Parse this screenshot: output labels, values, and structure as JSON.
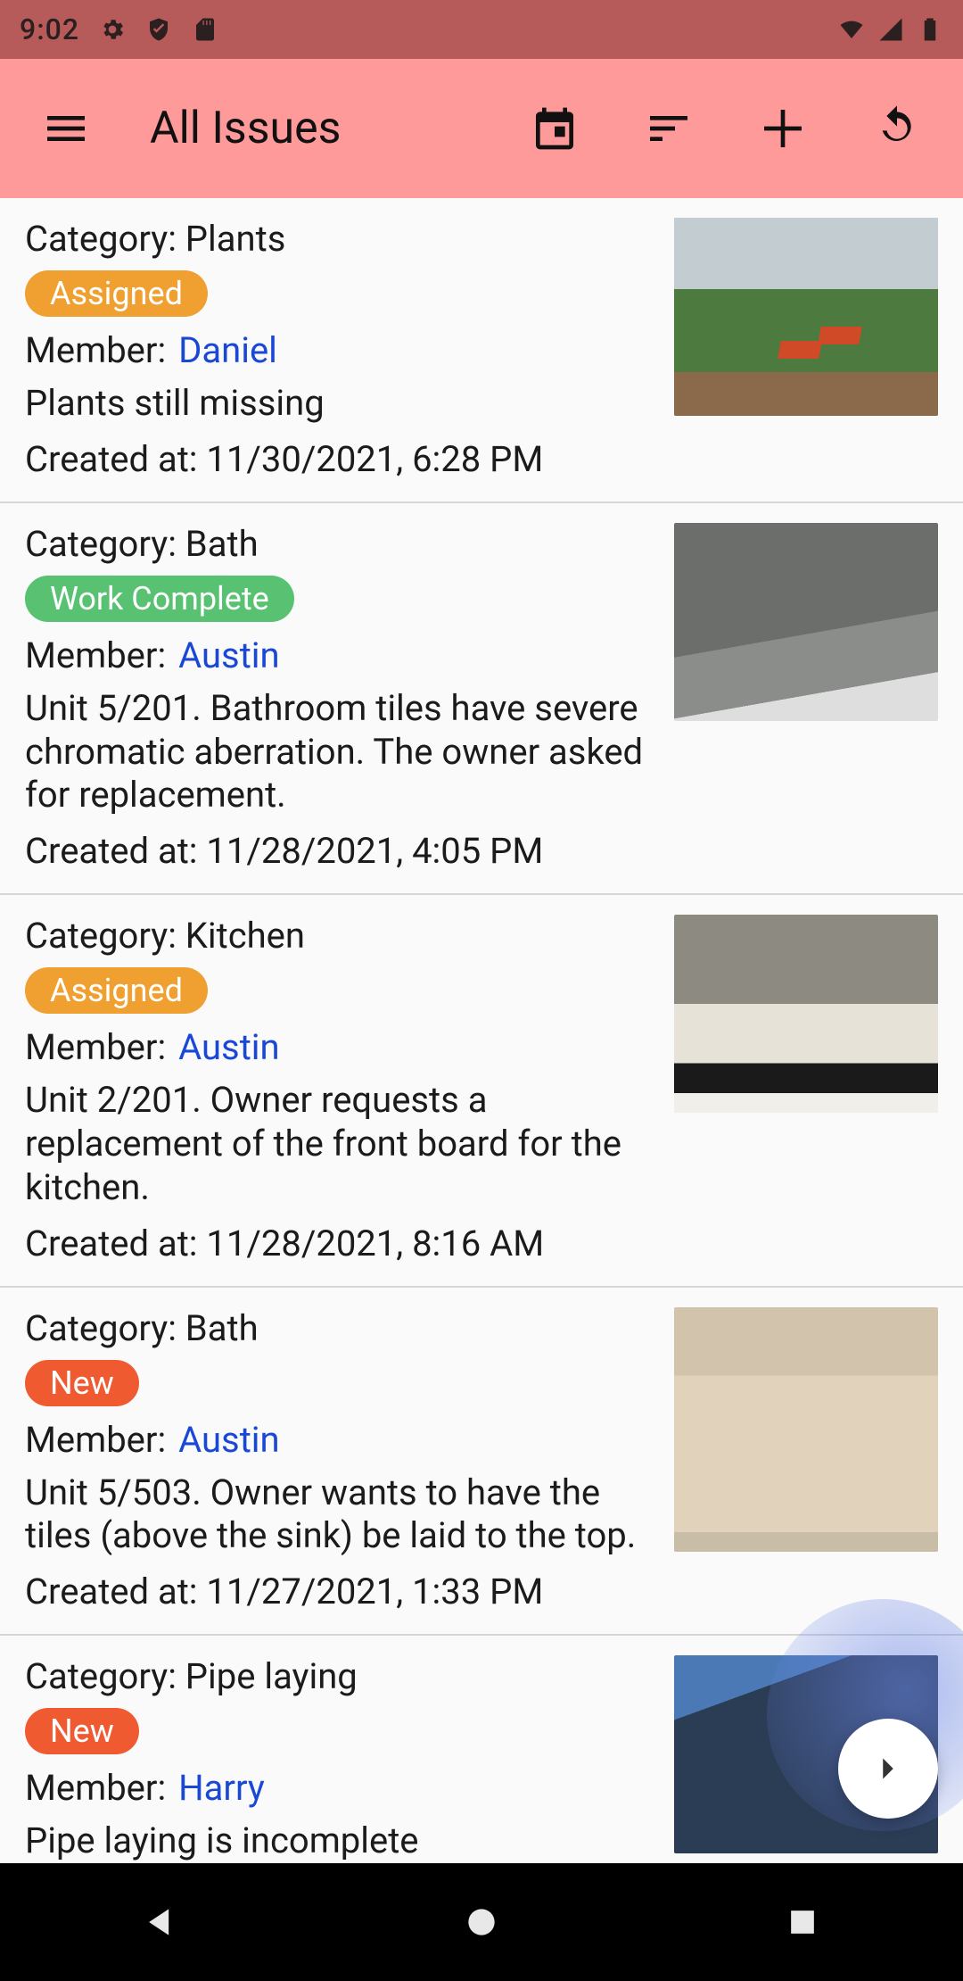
{
  "status": {
    "time": "9:02"
  },
  "appbar": {
    "title": "All Issues"
  },
  "labels": {
    "category_prefix": "Category: ",
    "member_prefix": "Member:",
    "created_prefix": "Created at: "
  },
  "status_kinds": {
    "assigned": "Assigned",
    "complete": "Work Complete",
    "new": "New"
  },
  "status_colors": {
    "assigned": "#f0a030",
    "complete": "#58c172",
    "new": "#f05a30"
  },
  "accent": {
    "link": "#1a48d6"
  },
  "issues": [
    {
      "category": "Plants",
      "status": "assigned",
      "member": "Daniel",
      "description": "Plants still missing",
      "created": "11/30/2021, 6:28 PM",
      "thumb": "plants"
    },
    {
      "category": "Bath",
      "status": "complete",
      "member": "Austin",
      "description": "Unit 5/201. Bathroom tiles have severe chromatic aberration. The owner asked for replacement.",
      "created": "11/28/2021, 4:05 PM",
      "thumb": "bath1"
    },
    {
      "category": "Kitchen",
      "status": "assigned",
      "member": "Austin",
      "description": "Unit 2/201. Owner requests a replacement of the front board for the kitchen.",
      "created": "11/28/2021, 8:16 AM",
      "thumb": "kitchen"
    },
    {
      "category": "Bath",
      "status": "new",
      "member": "Austin",
      "description": "Unit 5/503. Owner wants to have the tiles (above the sink) be laid to the top.",
      "created": "11/27/2021, 1:33 PM",
      "thumb": "bath2"
    },
    {
      "category": "Pipe laying",
      "status": "new",
      "member": "Harry",
      "description": "Pipe laying is incomplete",
      "created": "",
      "thumb": "pipe"
    }
  ]
}
